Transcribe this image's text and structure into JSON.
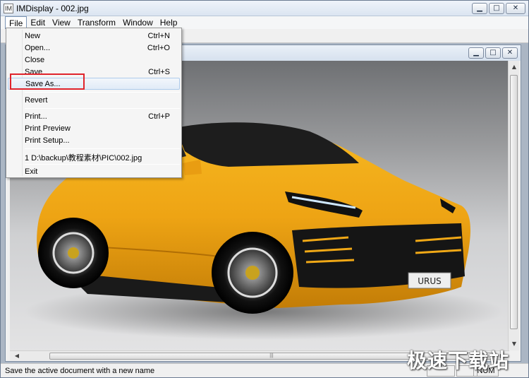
{
  "window": {
    "title": "IMDisplay - 002.jpg",
    "controls": {
      "minimize": "▁",
      "maximize": "□",
      "close": "✕"
    }
  },
  "menu_bar": {
    "items": [
      "File",
      "Edit",
      "View",
      "Transform",
      "Window",
      "Help"
    ],
    "active": "File"
  },
  "file_menu": {
    "items": [
      {
        "label": "New",
        "shortcut": "Ctrl+N"
      },
      {
        "label": "Open...",
        "shortcut": "Ctrl+O"
      },
      {
        "label": "Close",
        "shortcut": ""
      },
      {
        "label": "Save",
        "shortcut": "Ctrl+S"
      },
      {
        "label": "Save As...",
        "shortcut": ""
      },
      {
        "label": "Revert",
        "shortcut": ""
      },
      {
        "label": "Print...",
        "shortcut": "Ctrl+P"
      },
      {
        "label": "Print Preview",
        "shortcut": ""
      },
      {
        "label": "Print Setup...",
        "shortcut": ""
      },
      {
        "label": "1 D:\\backup\\教程素材\\PIC\\002.jpg",
        "shortcut": ""
      },
      {
        "label": "Exit",
        "shortcut": ""
      }
    ],
    "hovered": "Save As..."
  },
  "image": {
    "plate_text": "URUS"
  },
  "status_bar": {
    "message": "Save the active document with a new name",
    "num": "NUM"
  },
  "watermark": "极速下载站",
  "icons": {
    "app_icon": "app-icon",
    "scroll_left": "◀",
    "scroll_right": "▶",
    "scroll_up": "▲",
    "scroll_down": "▼",
    "grip": "|||"
  }
}
